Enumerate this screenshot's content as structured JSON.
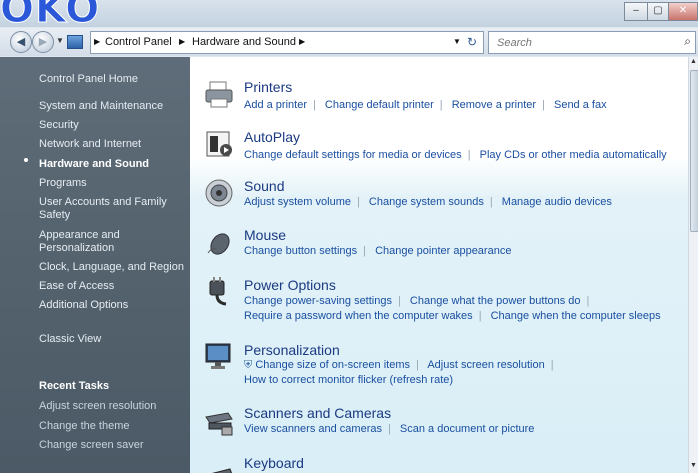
{
  "watermark_text": "OKO",
  "window": {
    "minimize": "–",
    "maximize": "▢",
    "close": "✕"
  },
  "address": {
    "crumbs": [
      "Control Panel",
      "Hardware and Sound"
    ],
    "search_placeholder": "Search"
  },
  "sidebar": {
    "items": [
      {
        "label": "Control Panel Home"
      },
      {
        "label": "System and Maintenance"
      },
      {
        "label": "Security"
      },
      {
        "label": "Network and Internet"
      },
      {
        "label": "Hardware and Sound"
      },
      {
        "label": "Programs"
      },
      {
        "label": "User Accounts and Family Safety"
      },
      {
        "label": "Appearance and Personalization"
      },
      {
        "label": "Clock, Language, and Region"
      },
      {
        "label": "Ease of Access"
      },
      {
        "label": "Additional Options"
      },
      {
        "label": "Classic View"
      }
    ],
    "recent_title": "Recent Tasks",
    "recent": [
      "Adjust screen resolution",
      "Change the theme",
      "Change screen saver"
    ]
  },
  "categories": [
    {
      "title": "Printers",
      "lines": [
        [
          "Add a printer",
          "Change default printer",
          "Remove a printer",
          "Send a fax"
        ]
      ]
    },
    {
      "title": "AutoPlay",
      "lines": [
        [
          "Change default settings for media or devices",
          "Play CDs or other media automatically"
        ]
      ]
    },
    {
      "title": "Sound",
      "lines": [
        [
          "Adjust system volume",
          "Change system sounds",
          "Manage audio devices"
        ]
      ]
    },
    {
      "title": "Mouse",
      "lines": [
        [
          "Change button settings",
          "Change pointer appearance"
        ]
      ]
    },
    {
      "title": "Power Options",
      "lines": [
        [
          "Change power-saving settings",
          "Change what the power buttons do"
        ],
        [
          "Require a password when the computer wakes",
          "Change when the computer sleeps"
        ]
      ]
    },
    {
      "title": "Personalization",
      "lines": [
        [
          "Change size of on-screen items",
          "Adjust screen resolution"
        ],
        [
          "How to correct monitor flicker (refresh rate)"
        ]
      ]
    },
    {
      "title": "Scanners and Cameras",
      "lines": [
        [
          "View scanners and cameras",
          "Scan a document or picture"
        ]
      ]
    },
    {
      "title": "Keyboard",
      "lines": []
    }
  ]
}
